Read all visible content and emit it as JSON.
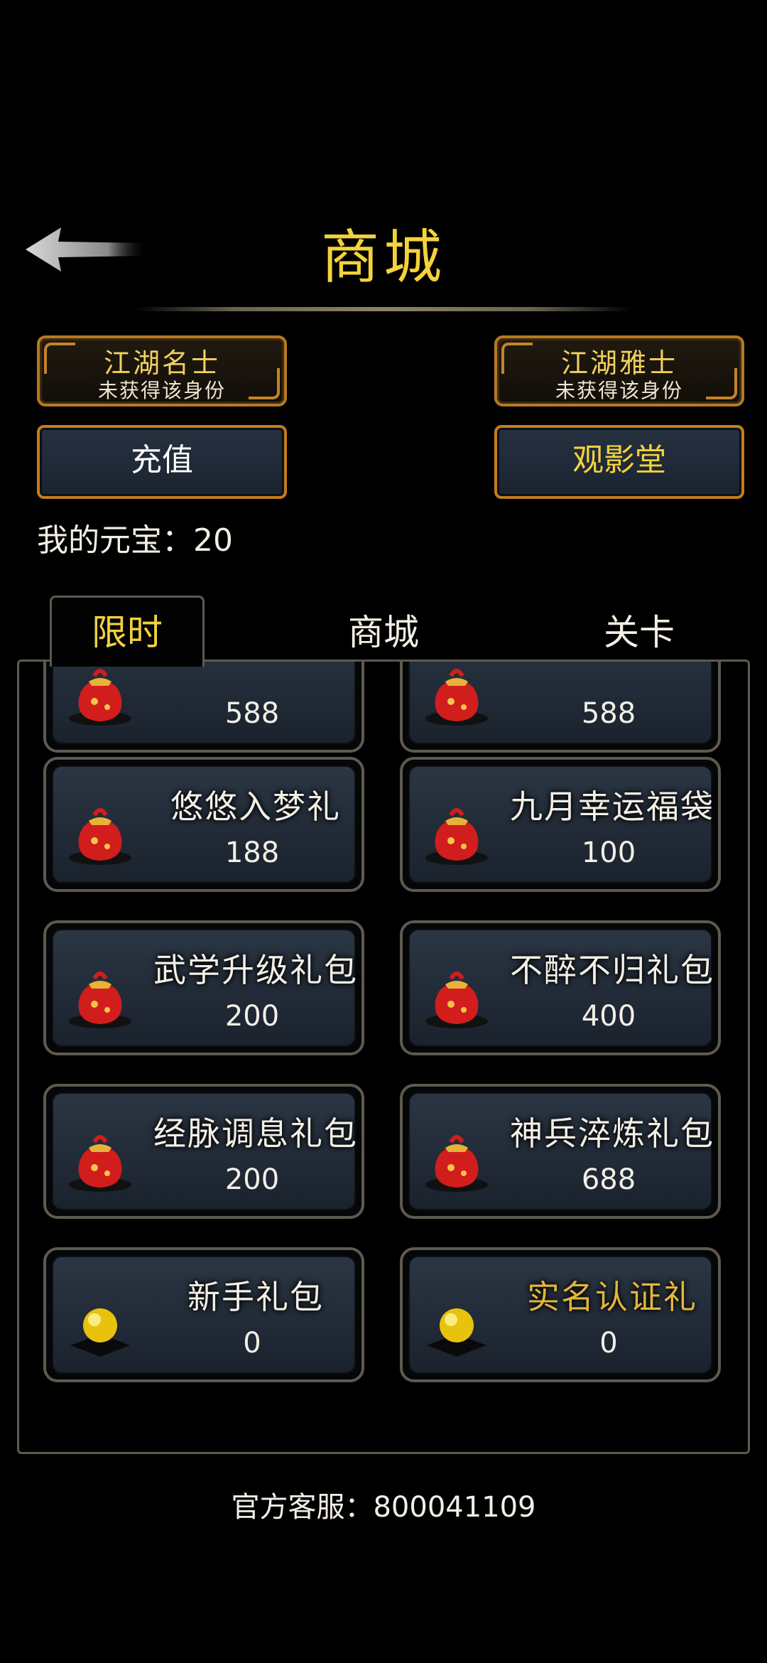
{
  "header": {
    "title": "商城"
  },
  "badges": [
    {
      "name": "江湖名士",
      "status": "未获得该身份"
    },
    {
      "name": "江湖雅士",
      "status": "未获得该身份"
    }
  ],
  "buttons": {
    "recharge": "充值",
    "cinema": "观影堂"
  },
  "currency": {
    "label": "我的元宝：",
    "value": "20"
  },
  "tabs": [
    {
      "label": "限时",
      "active": true
    },
    {
      "label": "商城",
      "active": false
    },
    {
      "label": "关卡",
      "active": false
    }
  ],
  "items": [
    {
      "name": "",
      "price": "588",
      "icon": "red-gift-bag-icon"
    },
    {
      "name": "",
      "price": "588",
      "icon": "red-gift-bag-icon"
    },
    {
      "name": "悠悠入梦礼",
      "price": "188",
      "icon": "red-gift-bag-icon"
    },
    {
      "name": "九月幸运福袋",
      "price": "100",
      "icon": "red-gift-bag-icon"
    },
    {
      "name": "武学升级礼包",
      "price": "200",
      "icon": "red-gift-bag-icon"
    },
    {
      "name": "不醉不归礼包",
      "price": "400",
      "icon": "red-gift-bag-icon"
    },
    {
      "name": "经脉调息礼包",
      "price": "200",
      "icon": "red-gift-bag-icon"
    },
    {
      "name": "神兵淬炼礼包",
      "price": "688",
      "icon": "red-gift-bag-icon"
    },
    {
      "name": "新手礼包",
      "price": "0",
      "icon": "gold-orb-icon"
    },
    {
      "name": "实名认证礼",
      "price": "0",
      "icon": "gold-orb-icon",
      "highlight": true
    }
  ],
  "footer": {
    "service": "官方客服：800041109"
  },
  "colors": {
    "gold": "#f4d23b",
    "orange_border": "#c47d1c",
    "card_bg": "#2b3644",
    "background": "#000000"
  }
}
